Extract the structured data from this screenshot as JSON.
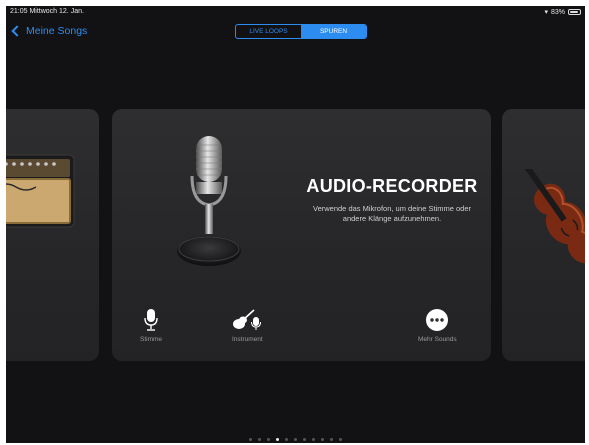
{
  "status_bar": {
    "time_date": "21:05  Mittwoch 12. Jan.",
    "battery": "83%"
  },
  "nav": {
    "back_label": "Meine Songs",
    "segments": [
      "LIVE LOOPS",
      "SPUREN"
    ],
    "selected_segment": "SPUREN"
  },
  "main_card": {
    "title": "AUDIO-RECORDER",
    "description": "Verwende das Mikrofon, um deine Stimme oder andere Klänge aufzunehmen.",
    "options": [
      {
        "label": "Stimme",
        "icon": "microphone-icon"
      },
      {
        "label": "Instrument",
        "icon": "guitar-mic-icon"
      },
      {
        "label": "Mehr Sounds",
        "icon": "more-dots-icon"
      }
    ]
  },
  "side_cards": {
    "left": "amplifier",
    "right": "violin"
  },
  "page_indicator": {
    "total": 11,
    "current": 4
  },
  "colors": {
    "accent": "#2d8cf0",
    "background": "#121214",
    "card": "#2a2a2c"
  }
}
